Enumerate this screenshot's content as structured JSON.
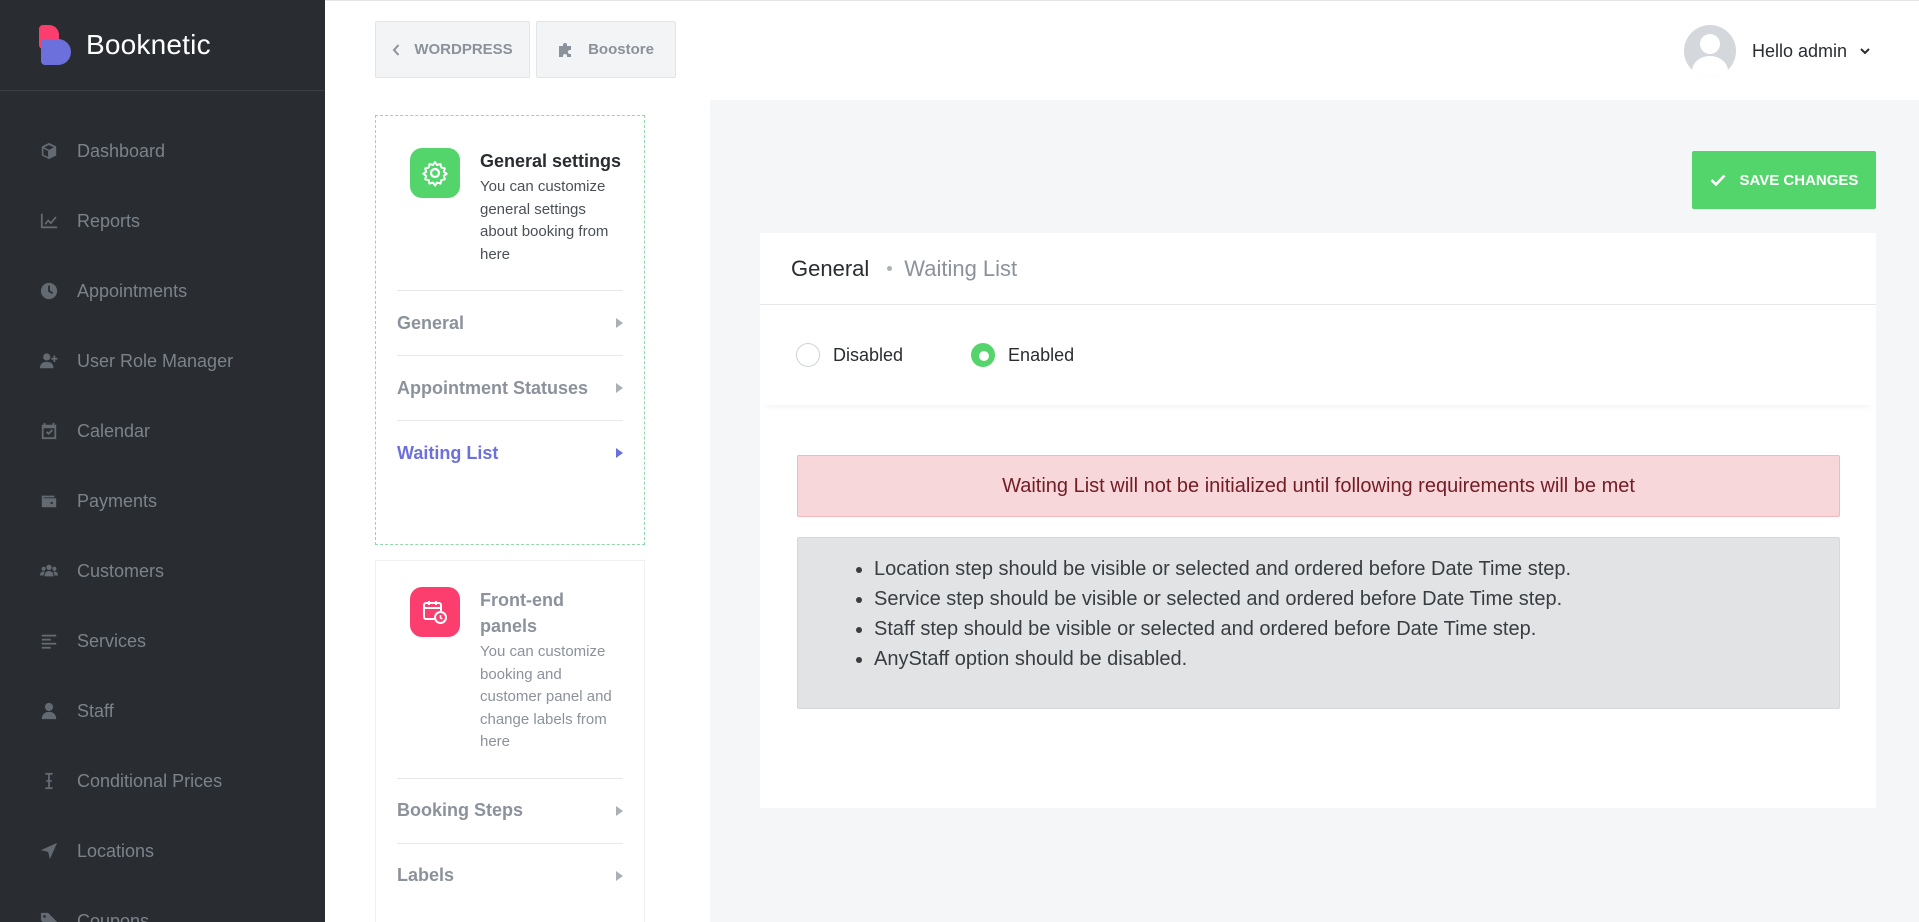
{
  "brand": {
    "name": "Booknetic"
  },
  "sidebar": {
    "items": [
      {
        "label": "Dashboard",
        "icon": "cube-icon"
      },
      {
        "label": "Reports",
        "icon": "chart-line-icon"
      },
      {
        "label": "Appointments",
        "icon": "clock-icon"
      },
      {
        "label": "User Role Manager",
        "icon": "user-plus-icon"
      },
      {
        "label": "Calendar",
        "icon": "calendar-check-icon"
      },
      {
        "label": "Payments",
        "icon": "wallet-icon"
      },
      {
        "label": "Customers",
        "icon": "users-icon"
      },
      {
        "label": "Services",
        "icon": "align-left-icon"
      },
      {
        "label": "Staff",
        "icon": "user-icon"
      },
      {
        "label": "Conditional Prices",
        "icon": "i-cursor-icon"
      },
      {
        "label": "Locations",
        "icon": "location-arrow-icon"
      },
      {
        "label": "Coupons",
        "icon": "tag-icon"
      }
    ]
  },
  "topbar": {
    "wordpress_label": "WORDPRESS",
    "boostore_label": "Boostore",
    "greeting": "Hello admin"
  },
  "settings": {
    "general_card": {
      "title": "General settings",
      "description": "You can customize general settings about booking from here",
      "items": [
        "General",
        "Appointment Statuses",
        "Waiting List"
      ],
      "active": "Waiting List"
    },
    "frontend_card": {
      "title": "Front-end panels",
      "description": "You can customize booking and customer panel and change labels from here",
      "items": [
        "Booking Steps",
        "Labels"
      ]
    }
  },
  "main": {
    "save_label": "SAVE CHANGES",
    "breadcrumb_main": "General",
    "breadcrumb_sub": "Waiting List",
    "radio_disabled": "Disabled",
    "radio_enabled": "Enabled",
    "selected": "Enabled",
    "alert": "Waiting List will not be initialized until following requirements will be met",
    "requirements": [
      "Location step should be visible or selected and ordered before Date Time step.",
      "Service step should be visible or selected and ordered before Date Time step.",
      "Staff step should be visible or selected and ordered before Date Time step.",
      "AnyStaff option should be disabled."
    ]
  },
  "colors": {
    "sidebar_bg": "#292d32",
    "accent_green": "#53d56c",
    "accent_purple": "#6c70dc",
    "accent_pink": "#fb3e6e",
    "alert_bg": "#f8d7da",
    "alert_text": "#721c24"
  }
}
